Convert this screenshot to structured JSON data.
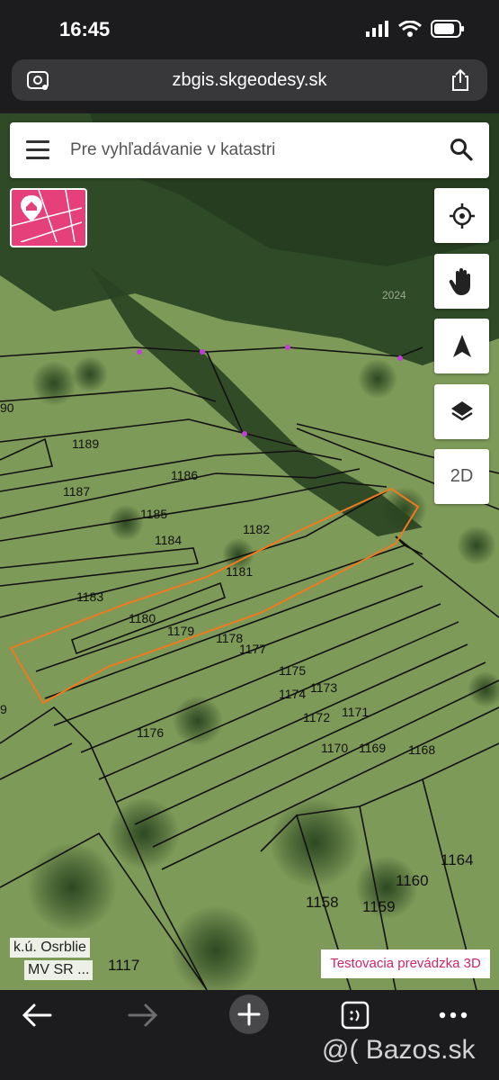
{
  "status_bar": {
    "time": "16:45"
  },
  "browser": {
    "url": "zbgis.skgeodesy.sk"
  },
  "search": {
    "placeholder": "Pre vyhľadávanie v katastri"
  },
  "map": {
    "controls": {
      "mode_2d_label": "2D"
    },
    "cadastral_area_label": "k.ú. Osrblie",
    "attribution_label": "MV SR ...",
    "testing_label": "Testovacia prevádzka 3D",
    "parcels": [
      "90",
      "1189",
      "1187",
      "1186",
      "1185",
      "1184",
      "1182",
      "1181",
      "1183",
      "1180",
      "1179",
      "1178",
      "1177",
      "1175",
      "1174",
      "1173",
      "1172",
      "1171",
      "1170",
      "1169",
      "1168",
      "1176",
      "1164",
      "1160",
      "1158",
      "1159",
      "1117",
      "9",
      "2024"
    ]
  },
  "watermark": "@( Bazos.sk",
  "colors": {
    "accent_pink": "#e5407a",
    "selection_orange": "#f07a1e",
    "testing_text": "#d02569"
  }
}
